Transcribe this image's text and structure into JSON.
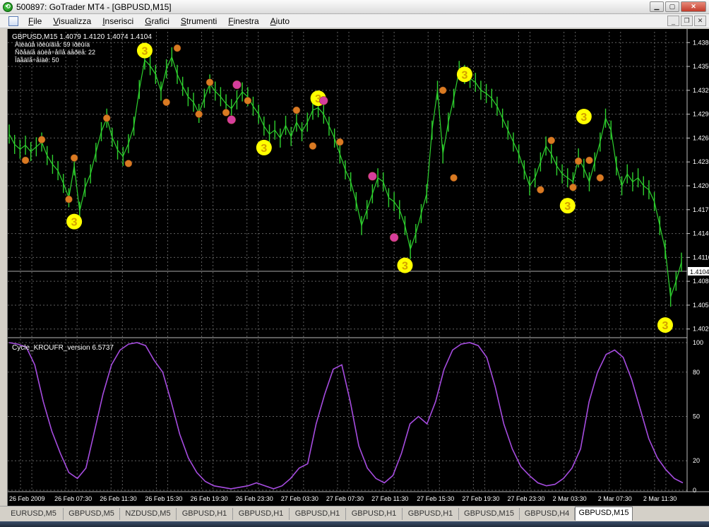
{
  "window": {
    "title": "500897: GoTrader MT4 - [GBPUSD,M15]"
  },
  "menu": [
    "File",
    "Visualizza",
    "Inserisci",
    "Grafici",
    "Strumenti",
    "Finestra",
    "Aiuto"
  ],
  "price_chart": {
    "header": "GBPUSD,M15  1.4079 1.4120 1.4074 1.4104",
    "info_lines": [
      "Àïëàûå íðêûíãíå: 59 íðêûíà",
      "Ñðåäíå áûëå÷åíîå áåðëå: 22",
      "Îâåäîå÷åíàê: 50"
    ],
    "current_price": "1.4104",
    "y_labels": [
      "1.4380",
      "1.4350",
      "1.4320",
      "1.4290",
      "1.4260",
      "1.4230",
      "1.4200",
      "1.4170",
      "1.4140",
      "1.4110",
      "1.4080",
      "1.4050",
      "1.4020"
    ],
    "marker_label": "3"
  },
  "indicator": {
    "name": "Cycle_KROUFR_version 6.5737",
    "y_labels": [
      "100",
      "80",
      "50",
      "20",
      "0"
    ]
  },
  "x_labels": [
    "26 Feb 2009",
    "26 Feb 07:30",
    "26 Feb 11:30",
    "26 Feb 15:30",
    "26 Feb 19:30",
    "26 Feb 23:30",
    "27 Feb 03:30",
    "27 Feb 07:30",
    "27 Feb 11:30",
    "27 Feb 15:30",
    "27 Feb 19:30",
    "27 Feb 23:30",
    "2 Mar 03:30",
    "2 Mar 07:30",
    "2 Mar 11:30"
  ],
  "tabs": [
    {
      "label": "EURUSD,M5",
      "active": false
    },
    {
      "label": "GBPUSD,M5",
      "active": false
    },
    {
      "label": "NZDUSD,M5",
      "active": false
    },
    {
      "label": "GBPUSD,H1",
      "active": false
    },
    {
      "label": "GBPUSD,H1",
      "active": false
    },
    {
      "label": "GBPUSD,H1",
      "active": false
    },
    {
      "label": "GBPUSD,H1",
      "active": false
    },
    {
      "label": "GBPUSD,H1",
      "active": false
    },
    {
      "label": "GBPUSD,M15",
      "active": false
    },
    {
      "label": "GBPUSD,H4",
      "active": false
    },
    {
      "label": "GBPUSD,M15",
      "active": true
    }
  ],
  "colors": {
    "background": "#000000",
    "grid": "#606060",
    "price_line": "#2ed12e",
    "indicator_line": "#a64ce0",
    "marker_yellow": "#ffff00",
    "marker_orange": "#d97a22",
    "marker_magenta": "#d63e9c",
    "text": "#ffffff"
  },
  "chart_data": {
    "type": "line",
    "title": "GBPUSD,M15",
    "ylim": [
      1.401,
      1.439
    ],
    "series": [
      {
        "name": "GBPUSD,M15",
        "values": [
          1.4265,
          1.4252,
          1.4246,
          1.4251,
          1.4243,
          1.4249,
          1.4255,
          1.4238,
          1.4227,
          1.4219,
          1.4203,
          1.4185,
          1.4225,
          1.4168,
          1.4198,
          1.4215,
          1.4242,
          1.4268,
          1.4285,
          1.4261,
          1.4245,
          1.4237,
          1.4253,
          1.4275,
          1.4321,
          1.4358,
          1.4351,
          1.434,
          1.4319,
          1.4347,
          1.4362,
          1.434,
          1.4325,
          1.4312,
          1.4305,
          1.4291,
          1.431,
          1.4328,
          1.4319,
          1.4312,
          1.4303,
          1.4297,
          1.4308,
          1.4318,
          1.4312,
          1.43,
          1.429,
          1.4275,
          1.4265,
          1.427,
          1.426,
          1.4276,
          1.4262,
          1.428,
          1.4268,
          1.428,
          1.4295,
          1.4298,
          1.429,
          1.4275,
          1.426,
          1.424,
          1.422,
          1.4205,
          1.418,
          1.415,
          1.417,
          1.419,
          1.421,
          1.4205,
          1.4185,
          1.418,
          1.417,
          1.415,
          1.412,
          1.414,
          1.4165,
          1.419,
          1.427,
          1.432,
          1.424,
          1.428,
          1.431,
          1.4345,
          1.434,
          1.4335,
          1.433,
          1.432,
          1.4316,
          1.431,
          1.43,
          1.4285,
          1.427,
          1.4255,
          1.424,
          1.422,
          1.42,
          1.421,
          1.423,
          1.425,
          1.424,
          1.4225,
          1.4215,
          1.421,
          1.4205,
          1.4235,
          1.4222,
          1.4205,
          1.423,
          1.4255,
          1.4285,
          1.427,
          1.4225,
          1.42,
          1.4215,
          1.4205,
          1.421,
          1.42,
          1.4195,
          1.418,
          1.415,
          1.412,
          1.406,
          1.408,
          1.4104
        ]
      },
      {
        "name": "Cycle_KROUFR_version 6.5737",
        "values": [
          100,
          99,
          97,
          85,
          60,
          40,
          25,
          12,
          8,
          15,
          40,
          65,
          85,
          95,
          99,
          100,
          98,
          88,
          80,
          60,
          38,
          22,
          12,
          6,
          3,
          2,
          1,
          2,
          3,
          5,
          3,
          1,
          3,
          8,
          15,
          18,
          45,
          65,
          82,
          85,
          60,
          30,
          15,
          8,
          5,
          10,
          25,
          45,
          50,
          45,
          60,
          82,
          95,
          99,
          100,
          98,
          90,
          70,
          45,
          28,
          16,
          10,
          5,
          3,
          4,
          8,
          15,
          28,
          60,
          80,
          92,
          95,
          90,
          75,
          55,
          35,
          22,
          14,
          8,
          5
        ]
      }
    ],
    "markers": [
      {
        "type": "yellow",
        "price": 1.437
      },
      {
        "type": "yellow",
        "price": 1.4155
      },
      {
        "type": "yellow",
        "price": 1.4248
      },
      {
        "type": "yellow",
        "price": 1.431
      },
      {
        "type": "yellow",
        "price": 1.41
      },
      {
        "type": "yellow",
        "price": 1.434
      },
      {
        "type": "yellow",
        "price": 1.4287
      },
      {
        "type": "yellow",
        "price": 1.4175
      },
      {
        "type": "yellow",
        "price": 1.4025
      }
    ]
  }
}
